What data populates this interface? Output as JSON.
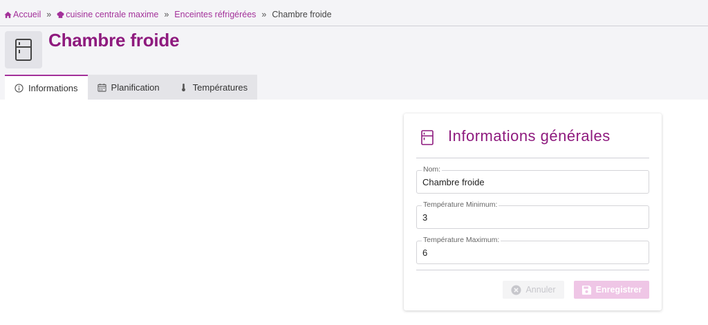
{
  "breadcrumb": {
    "home": "Accueil",
    "site": "cuisine centrale maxime",
    "section": "Enceintes réfrigérées",
    "current": "Chambre froide",
    "separator": "»"
  },
  "page": {
    "title": "Chambre froide",
    "icon": "fridge-icon"
  },
  "tabs": [
    {
      "label": "Informations",
      "icon": "info-icon",
      "active": true
    },
    {
      "label": "Planification",
      "icon": "calendar-icon",
      "active": false
    },
    {
      "label": "Températures",
      "icon": "thermometer-icon",
      "active": false
    }
  ],
  "card": {
    "title": "Informations générales",
    "icon": "fridge-icon",
    "fields": [
      {
        "label": "Nom:",
        "value": "Chambre froide"
      },
      {
        "label": "Température Minimum:",
        "value": "3"
      },
      {
        "label": "Température Maximum:",
        "value": "6"
      }
    ],
    "buttons": {
      "cancel": "Annuler",
      "save": "Enregistrer"
    }
  },
  "colors": {
    "accent": "#8e1a7e",
    "link": "#a3319a",
    "header_bg": "#f4f4f7",
    "save_button_bg": "#efc6e6"
  }
}
